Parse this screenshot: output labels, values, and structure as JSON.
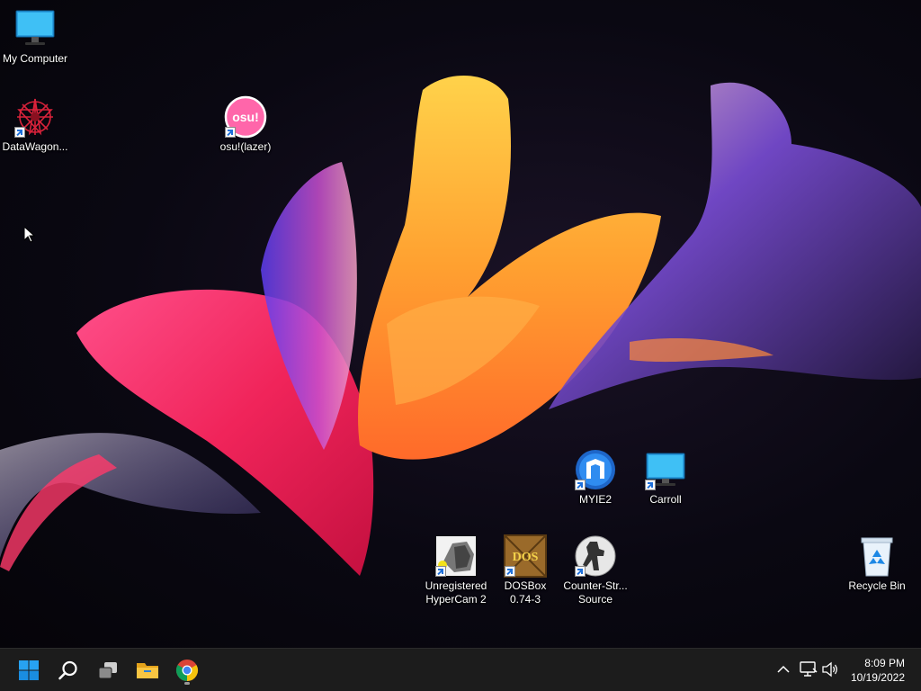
{
  "desktop": {
    "icons": [
      {
        "label": "My Computer",
        "icon": "monitor-icon",
        "shortcut": false
      },
      {
        "label": "DataWagon...",
        "icon": "datawagon-icon",
        "shortcut": true
      },
      {
        "label": "osu!(lazer)",
        "icon": "osu-icon",
        "icon_text": "osu!",
        "shortcut": true
      },
      {
        "label": "MYIE2",
        "icon": "myie2-icon",
        "shortcut": true
      },
      {
        "label": "Carroll",
        "icon": "monitor-icon",
        "shortcut": true
      },
      {
        "label": "Unregistered\nHyperCam 2",
        "icon": "hypercam-icon",
        "shortcut": true
      },
      {
        "label": "DOSBox\n0.74-3",
        "icon": "dosbox-icon",
        "icon_text": "DOS",
        "shortcut": true
      },
      {
        "label": "Counter-Str...\nSource",
        "icon": "counter-strike-icon",
        "shortcut": true
      },
      {
        "label": "Recycle Bin",
        "icon": "recycle-bin-icon",
        "shortcut": false
      }
    ]
  },
  "taskbar": {
    "buttons": [
      {
        "name": "start",
        "icon": "windows-start-icon"
      },
      {
        "name": "search",
        "icon": "search-icon"
      },
      {
        "name": "task-view",
        "icon": "task-view-icon"
      },
      {
        "name": "file-explorer",
        "icon": "folder-icon"
      },
      {
        "name": "chrome",
        "icon": "chrome-icon",
        "running": true
      }
    ],
    "tray": {
      "chevron": "chevron-up-icon",
      "network": "network-icon",
      "volume": "volume-icon"
    },
    "clock": {
      "time": "8:09 PM",
      "date": "10/19/2022"
    }
  },
  "colors": {
    "taskbar_bg": "#1c1c1c",
    "accent_blue": "#1e88e5",
    "osu_pink": "#ff66aa"
  }
}
